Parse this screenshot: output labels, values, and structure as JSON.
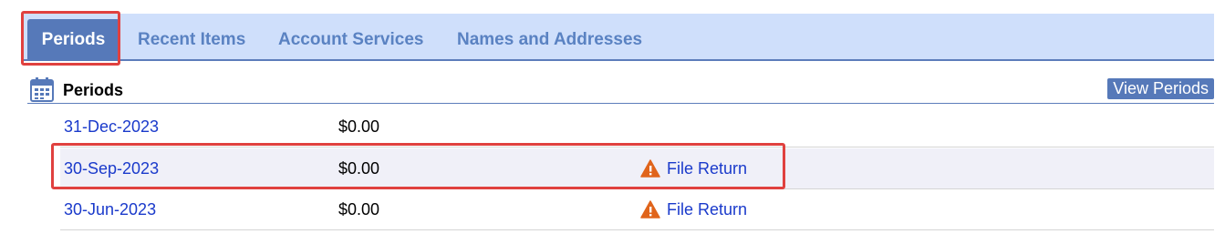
{
  "tabs": [
    {
      "label": "Periods",
      "active": true
    },
    {
      "label": "Recent Items"
    },
    {
      "label": "Account Services"
    },
    {
      "label": "Names and Addresses"
    }
  ],
  "section": {
    "title": "Periods",
    "icon": "calendar-icon",
    "view_button": "View Periods"
  },
  "periods": [
    {
      "date": "31-Dec-2023",
      "amount": "$0.00",
      "action": ""
    },
    {
      "date": "30-Sep-2023",
      "amount": "$0.00",
      "action": "File Return"
    },
    {
      "date": "30-Jun-2023",
      "amount": "$0.00",
      "action": "File Return"
    }
  ],
  "colors": {
    "tab_bar": "#cfdffb",
    "active_tab": "#5679b9",
    "link": "#1a3acb",
    "highlight": "#e0413f",
    "warning": "#e0641b"
  }
}
